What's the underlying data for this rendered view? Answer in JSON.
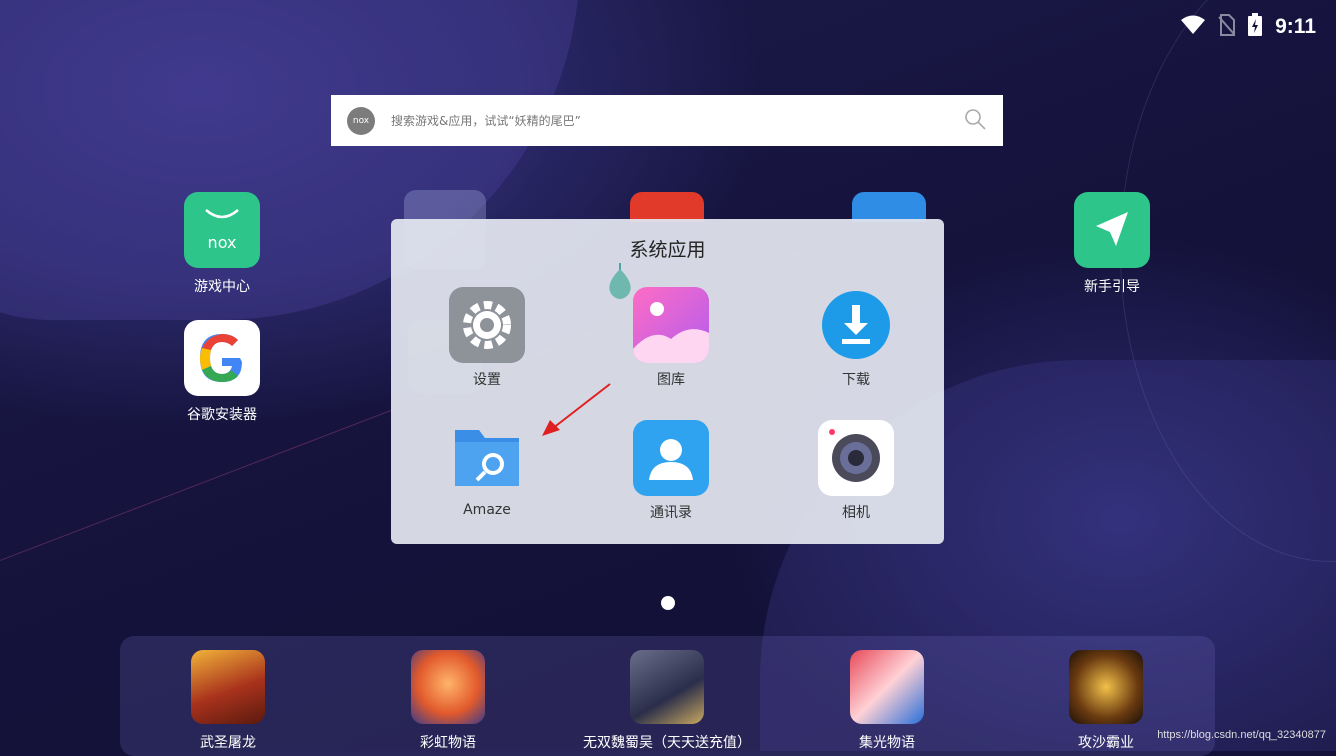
{
  "status_bar": {
    "time": "9:11",
    "icons": [
      "wifi-icon",
      "no-sim-icon",
      "battery-icon"
    ]
  },
  "search": {
    "logo_text": "nox",
    "placeholder": "搜索游戏&应用，试试“妖精的尾巴”",
    "icon": "search-icon"
  },
  "desktop_apps": [
    {
      "label": "游戏中心",
      "icon": "nox-game-center-icon"
    },
    {
      "label": "谷歌安装器",
      "icon": "google-installer-icon"
    },
    {
      "label": "新手引导",
      "icon": "guide-arrow-icon"
    }
  ],
  "folder": {
    "title": "系统应用",
    "items": [
      {
        "label": "设置",
        "icon": "gear-icon"
      },
      {
        "label": "图库",
        "icon": "gallery-icon"
      },
      {
        "label": "下载",
        "icon": "download-icon"
      },
      {
        "label": "Amaze",
        "icon": "amaze-folder-icon"
      },
      {
        "label": "通讯录",
        "icon": "contacts-icon"
      },
      {
        "label": "相机",
        "icon": "camera-icon"
      }
    ]
  },
  "page_indicator": {
    "current": 1,
    "total": 1
  },
  "dock": [
    {
      "label": "武圣屠龙",
      "icon": "game-wushengtulong-icon"
    },
    {
      "label": "彩虹物语",
      "icon": "game-caihongwuyu-icon"
    },
    {
      "label": "无双魏蜀吴（天天送充值）",
      "icon": "game-wushuang-icon"
    },
    {
      "label": "集光物语",
      "icon": "game-jiguangwuyu-icon"
    },
    {
      "label": "攻沙霸业",
      "icon": "game-gongshabaye-icon"
    }
  ],
  "watermark": "https://blog.csdn.net/qq_32340877",
  "colors": {
    "background": "#14123a",
    "annotation_arrow": "#e02020",
    "nox_green": "#2ec58a",
    "folder_panel": "#e1e4ee"
  }
}
